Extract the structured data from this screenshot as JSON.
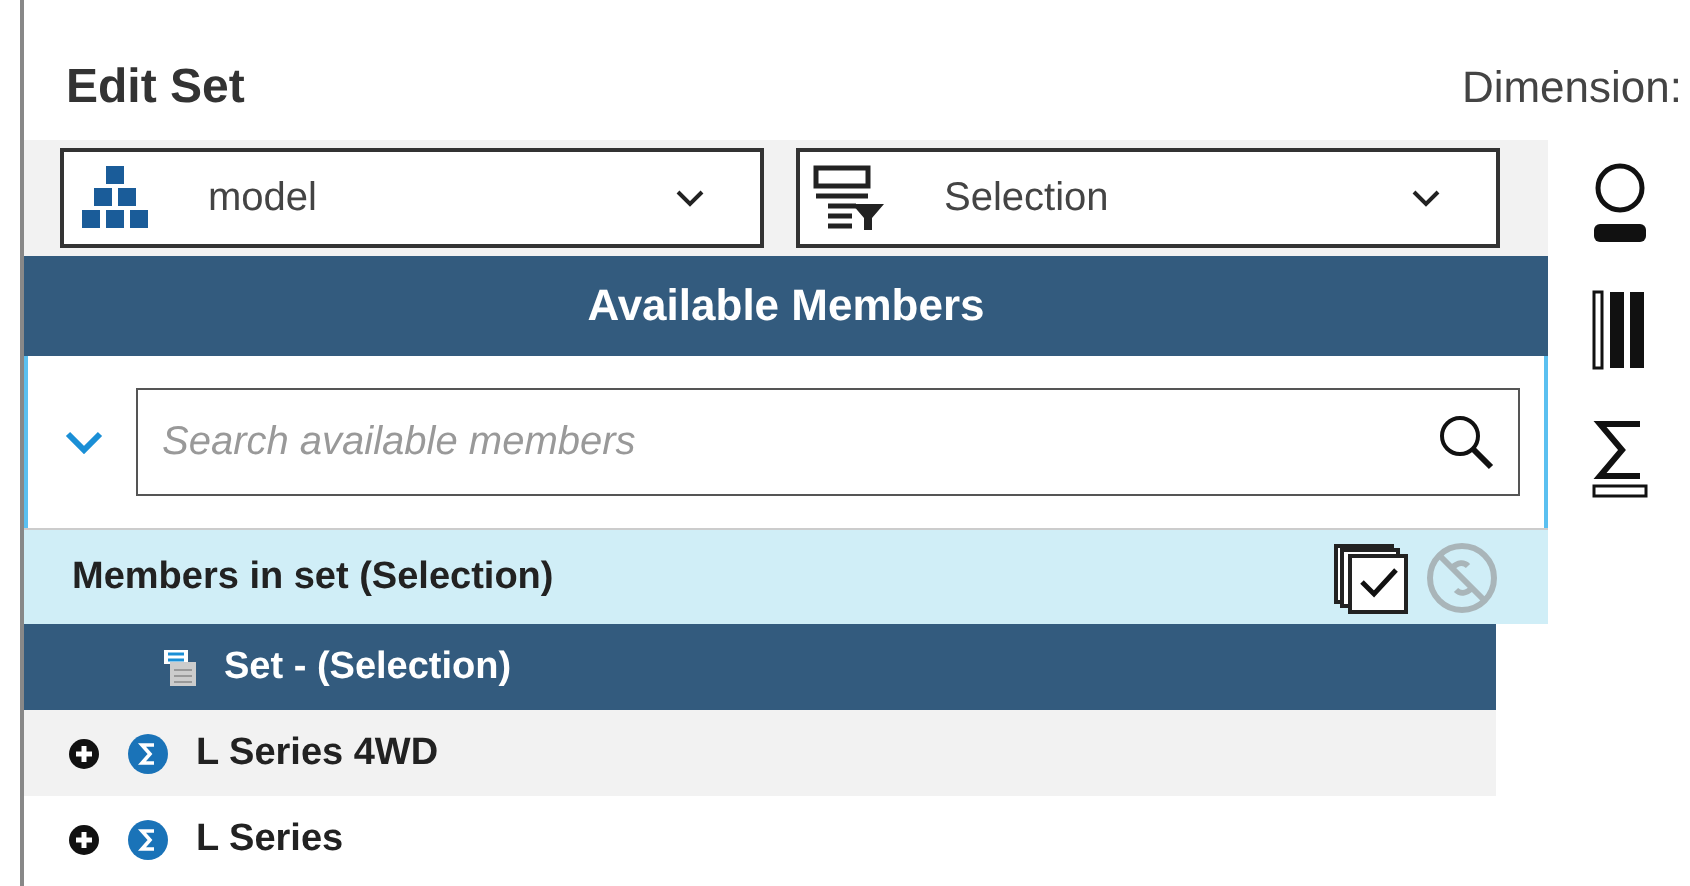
{
  "title": "Edit Set",
  "dimension_label": "Dimension:",
  "dropdowns": [
    {
      "kind": "model",
      "value": "model"
    },
    {
      "kind": "filter",
      "value": "Selection"
    }
  ],
  "side_tools": [
    {
      "kind": "person"
    },
    {
      "kind": "columns"
    },
    {
      "kind": "sigma"
    }
  ],
  "panel": {
    "header": "Available Members",
    "expanded": true,
    "search": {
      "placeholder": "Search available members"
    },
    "section": {
      "title": "Members in set (Selection)"
    },
    "rows": [
      {
        "kind": "set",
        "label": "Set - (Selection)",
        "selected": true
      },
      {
        "kind": "member",
        "label": "L Series 4WD",
        "selected": false
      },
      {
        "kind": "member",
        "label": "L Series",
        "selected": false
      }
    ]
  }
}
